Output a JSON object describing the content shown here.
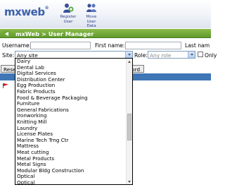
{
  "app": {
    "logo_text": "mxweb",
    "logo_mark": "®"
  },
  "toolbar": {
    "register_label_1": "Register",
    "register_label_2": "User",
    "move_label_1": "Move",
    "move_label_2": "User",
    "move_label_3": "Data"
  },
  "breadcrumb": {
    "root": "mxWeb",
    "separator": ">",
    "current": "User Manager"
  },
  "form": {
    "username_label": "Username:",
    "firstname_label": "First name:",
    "lastname_label": "Last nam",
    "site_label": "Site:",
    "site_value": "Any site",
    "role_label": "Role:",
    "role_value": "Any role",
    "only_label": "Only"
  },
  "buttons": {
    "reset_partial": "Reset",
    "record_partial": "ord"
  },
  "site_list": {
    "options": [
      "Dairy",
      "Dental Lab",
      "Digital Services",
      "Distribution Center",
      "Egg Production",
      "Fabric Products",
      "Food & Beverage Packaging",
      "Furniture",
      "General Fabrications",
      "Ironworking",
      "Knitting Mill",
      "Laundry",
      "License Plates",
      "Marine Tech Trng Ctr",
      "Mattress",
      "Meat cutting",
      "Metal Products",
      "Metal Signs",
      "Modular Bldg Construction",
      "Optical",
      "Optical"
    ]
  },
  "colors": {
    "crumb_green": "#6fa736",
    "header_blue": "#3e76b6",
    "logo_blue": "#3b5faa"
  }
}
